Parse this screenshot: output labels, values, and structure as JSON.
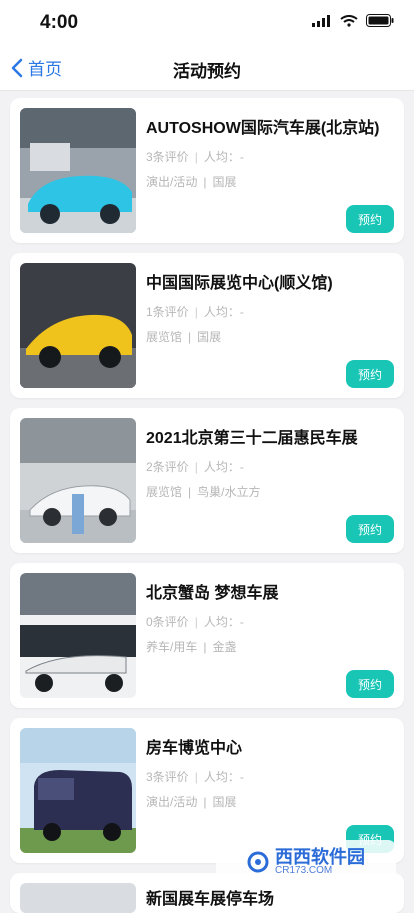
{
  "status_bar": {
    "time": "4:00"
  },
  "nav": {
    "back_label": "首页",
    "title": "活动预约"
  },
  "events": [
    {
      "name": "AUTOSHOW国际汽车展(北京站)",
      "reviews": "3条评价",
      "avg": "人均：-",
      "category": "演出/活动",
      "area": "国展",
      "button": "预约"
    },
    {
      "name": "中国国际展览中心(顺义馆)",
      "reviews": "1条评价",
      "avg": "人均：-",
      "category": "展览馆",
      "area": "国展",
      "button": "预约"
    },
    {
      "name": "2021北京第三十二届惠民车展",
      "reviews": "2条评价",
      "avg": "人均：-",
      "category": "展览馆",
      "area": "鸟巢/水立方",
      "button": "预约"
    },
    {
      "name": "北京蟹岛 梦想车展",
      "reviews": "0条评价",
      "avg": "人均：-",
      "category": "养车/用车",
      "area": "金盏",
      "button": "预约"
    },
    {
      "name": "房车博览中心",
      "reviews": "3条评价",
      "avg": "人均：-",
      "category": "演出/活动",
      "area": "国展",
      "button": "预约"
    },
    {
      "name": "新国展车展停车场",
      "reviews": "",
      "avg": "",
      "category": "",
      "area": "",
      "button": ""
    }
  ],
  "watermark": {
    "title": "西西软件园",
    "subtitle": "CR173.COM"
  }
}
